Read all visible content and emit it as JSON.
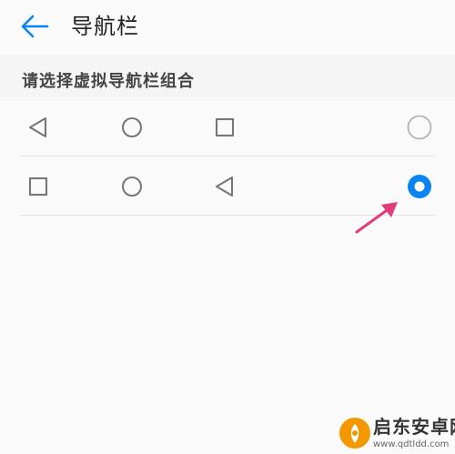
{
  "header": {
    "title": "导航栏",
    "back_icon": "arrow-left-icon"
  },
  "section": {
    "title": "请选择虚拟导航栏组合"
  },
  "options": [
    {
      "icons": [
        "back-triangle-icon",
        "home-circle-icon",
        "recents-square-icon"
      ],
      "selected": false
    },
    {
      "icons": [
        "recents-square-icon",
        "home-circle-icon",
        "back-triangle-icon"
      ],
      "selected": true
    }
  ],
  "colors": {
    "accent": "#0a84f0",
    "annotation_arrow": "#e13c7c",
    "icon_gray": "#777777"
  },
  "watermark": {
    "name": "启东安卓网",
    "url": "www.qdtldd.com"
  }
}
